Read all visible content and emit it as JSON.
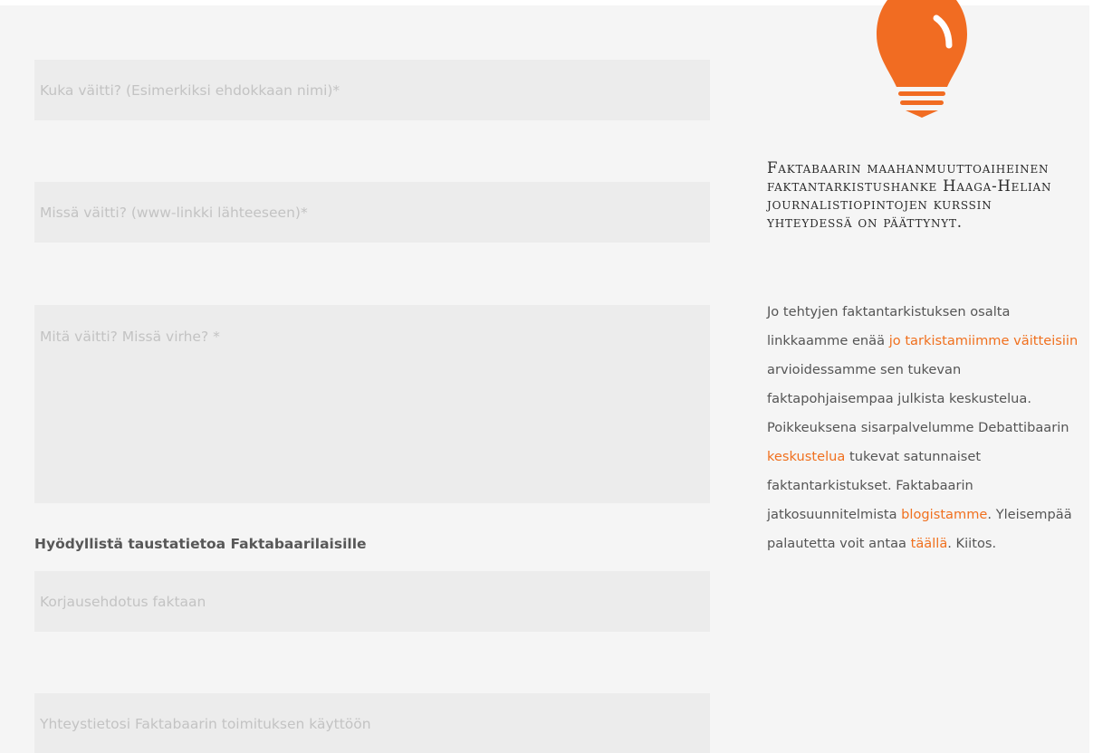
{
  "form": {
    "who_placeholder": "Kuka väitti? (Esimerkiksi ehdokkaan nimi)*",
    "where_placeholder": "Missä väitti? (www-linkki lähteeseen)*",
    "what_placeholder": "Mitä väitti? Missä virhe? *",
    "section_label": "Hyödyllistä taustatietoa Faktabaarilaisille",
    "correction_placeholder": "Korjausehdotus faktaan",
    "contact_placeholder": "Yhteystietosi Faktabaarin toimituksen käyttöön"
  },
  "sidebar": {
    "icon": "lightbulb-icon",
    "heading": "Faktabaarin maahanmuuttoaiheinen faktantarkistushanke Haaga-Helian journalistiopintojen kurssin yhteydessä on päättynyt.",
    "text_1": "Jo tehtyjen faktantarkistuksen osalta linkkaamme enää ",
    "link_1": "jo tarkistamiimme väitteisiin",
    "text_2": " arvioidessamme sen tukevan faktapohjaisempaa julkista keskustelua. Poikkeuksena sisarpalvelumme Debattibaarin ",
    "link_2": "keskustelua",
    "text_3": " tukevat satunnaiset faktantarkistukset. Faktabaarin jatkosuunnitelmista ",
    "link_3": "blogistamme",
    "text_4": ". Yleisempää palautetta voit antaa ",
    "link_4": "täällä",
    "text_5": ". Kiitos."
  },
  "colors": {
    "accent": "#f16c22",
    "panel_background": "#f5f5f5",
    "field_background": "#ececec"
  }
}
